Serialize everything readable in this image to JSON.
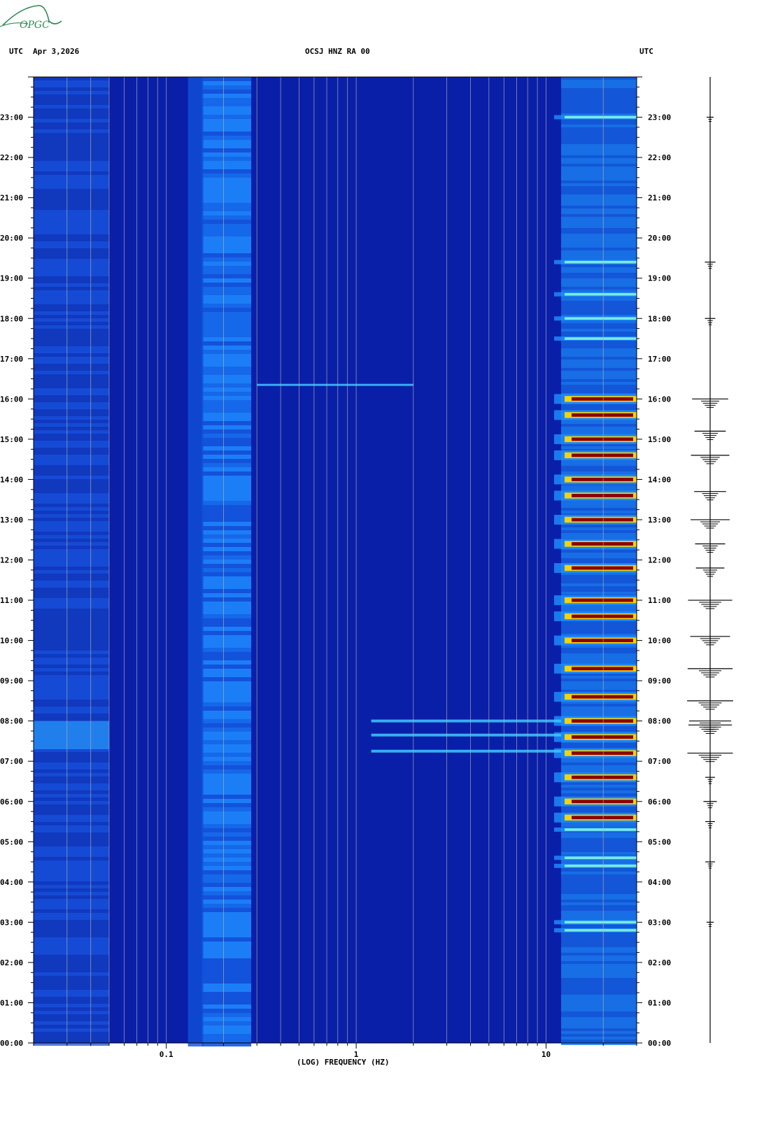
{
  "header": {
    "left_label": "UTC",
    "date": "Apr 3,2026",
    "station": "OCSJ HNZ RA 00",
    "right_label": "UTC"
  },
  "logo": {
    "text": "OPGC",
    "color": "#2e8b57"
  },
  "chart_data": {
    "type": "heatmap",
    "title": "OCSJ HNZ RA 00",
    "xlabel": "(LOG) FREQUENCY (HZ)",
    "ylabel": "UTC",
    "x_scale": "log",
    "xlim": [
      0.02,
      30
    ],
    "x_tick_labels": [
      "0.1",
      "1",
      "10"
    ],
    "x_ticks": [
      0.1,
      1,
      10
    ],
    "ylim": [
      0,
      24
    ],
    "y_tick_labels": [
      "00:00",
      "01:00",
      "02:00",
      "03:00",
      "04:00",
      "05:00",
      "06:00",
      "07:00",
      "08:00",
      "09:00",
      "10:00",
      "11:00",
      "12:00",
      "13:00",
      "14:00",
      "15:00",
      "16:00",
      "17:00",
      "18:00",
      "19:00",
      "20:00",
      "21:00",
      "22:00",
      "23:00"
    ],
    "grid_frequencies": [
      0.03,
      0.04,
      0.05,
      0.06,
      0.07,
      0.08,
      0.09,
      0.1,
      0.2,
      0.3,
      0.4,
      0.5,
      0.6,
      0.7,
      0.8,
      0.9,
      1,
      2,
      3,
      4,
      5,
      6,
      7,
      8,
      9,
      10,
      20
    ],
    "colors": {
      "background": "#0a1fa8",
      "low": "#0a1fa8",
      "mid": "#1e90ff",
      "high": "#ffd700",
      "peak": "#8b0000",
      "grid": "#b0b0b0"
    },
    "noise_band_hz": [
      0.13,
      0.28
    ],
    "high_freq_band_hz": [
      12,
      30
    ],
    "events_utc_hours": [
      23.0,
      19.4,
      18.6,
      18.0,
      17.5,
      16.0,
      15.6,
      15.0,
      14.6,
      14.0,
      13.6,
      13.0,
      12.4,
      11.8,
      11.0,
      10.6,
      10.0,
      9.3,
      8.6,
      8.0,
      7.6,
      7.2,
      6.6,
      6.0,
      5.6,
      5.3,
      4.6,
      4.4,
      3.0,
      2.8
    ],
    "trace": {
      "type": "seismogram",
      "event_utc_hours": [
        23.0,
        19.4,
        18.0,
        16.0,
        15.2,
        14.6,
        13.7,
        13.0,
        12.4,
        11.8,
        11.0,
        10.1,
        9.3,
        8.5,
        8.0,
        7.9,
        7.2,
        6.6,
        6.0,
        5.5,
        4.5,
        3.0
      ]
    }
  }
}
